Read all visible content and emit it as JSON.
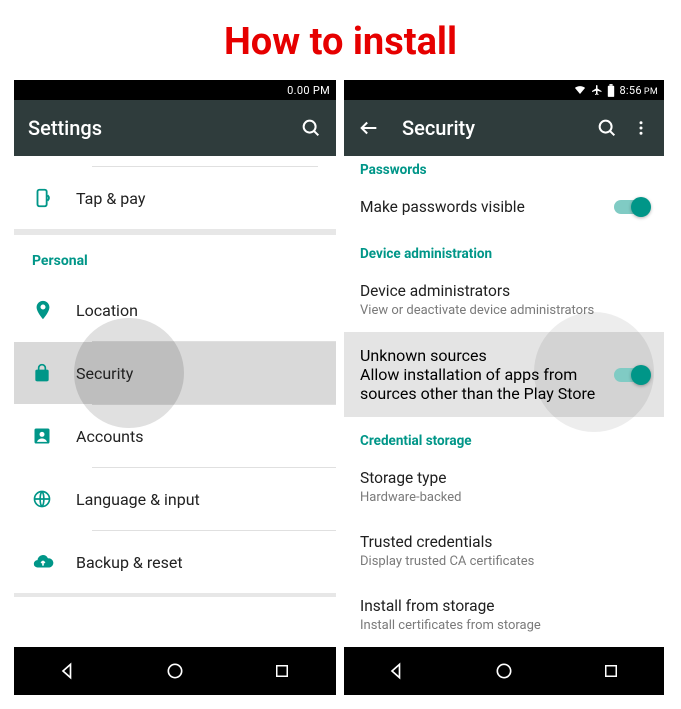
{
  "title": "How to install",
  "status": {
    "time": "8:56",
    "ampm": "PM"
  },
  "left": {
    "appbar_title": "Settings",
    "tap_pay": "Tap & pay",
    "section_personal": "Personal",
    "location": "Location",
    "security": "Security",
    "accounts": "Accounts",
    "language": "Language & input",
    "backup": "Backup & reset"
  },
  "right": {
    "appbar_title": "Security",
    "passwords_head": "Passwords",
    "make_visible": "Make passwords visible",
    "device_admin_head": "Device administration",
    "device_admins": "Device administrators",
    "device_admins_sub": "View or deactivate device administrators",
    "unknown_sources": "Unknown sources",
    "unknown_sources_sub": "Allow installation of apps from sources other than the Play Store",
    "cred_head": "Credential storage",
    "storage_type": "Storage type",
    "storage_type_sub": "Hardware-backed",
    "trusted": "Trusted credentials",
    "trusted_sub": "Display trusted CA certificates",
    "install_storage": "Install from storage",
    "install_storage_sub": "Install certificates from storage"
  }
}
